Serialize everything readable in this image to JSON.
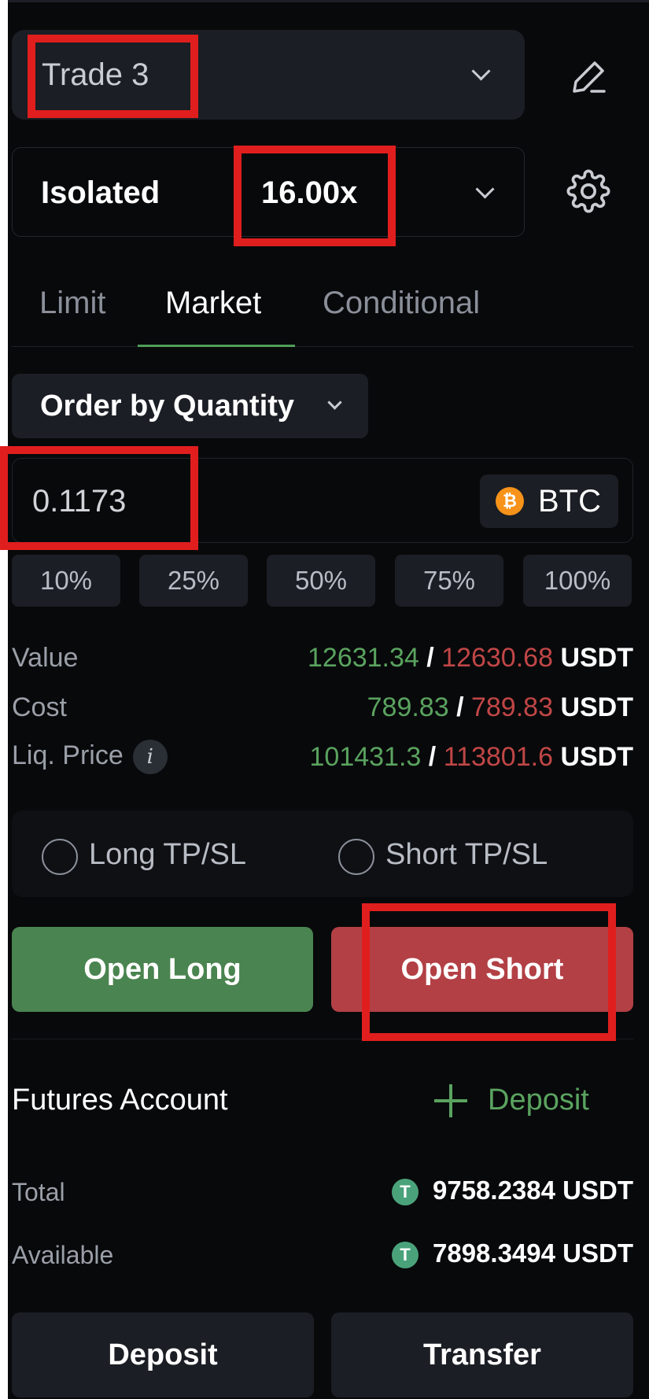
{
  "account_select": {
    "value": "Trade 3"
  },
  "margin": {
    "mode": "Isolated",
    "leverage": "16.00x"
  },
  "tabs": [
    {
      "label": "Limit",
      "active": false
    },
    {
      "label": "Market",
      "active": true
    },
    {
      "label": "Conditional",
      "active": false
    }
  ],
  "order_type": {
    "label": "Order by Quantity"
  },
  "quantity": {
    "value": "0.1173",
    "coin": "BTC",
    "coin_icon_glyph": "₿"
  },
  "percent_buttons": [
    "10%",
    "25%",
    "50%",
    "75%",
    "100%"
  ],
  "info": {
    "value": {
      "label": "Value",
      "long": "12631.34",
      "sep": "/",
      "short": "12630.68",
      "unit": "USDT"
    },
    "cost": {
      "label": "Cost",
      "long": "789.83",
      "sep": "/",
      "short": "789.83",
      "unit": "USDT"
    },
    "liq": {
      "label": "Liq. Price",
      "info_glyph": "i",
      "long": "101431.3",
      "sep": "/",
      "short": "113801.6",
      "unit": "USDT"
    }
  },
  "tpsl": {
    "long_label": "Long TP/SL",
    "short_label": "Short TP/SL"
  },
  "actions": {
    "open_long": "Open Long",
    "open_short": "Open Short"
  },
  "futures": {
    "title": "Futures Account",
    "deposit_link": "Deposit",
    "total_label": "Total",
    "total_value": "9758.2384 USDT",
    "available_label": "Available",
    "available_value": "7898.3494 USDT",
    "tether_glyph": "T"
  },
  "bottom": {
    "deposit": "Deposit",
    "transfer": "Transfer"
  },
  "colors": {
    "accent_green": "#4f9e58",
    "long_green": "#5aa35f",
    "short_red": "#c04646",
    "highlight_red": "#e01e1e"
  }
}
